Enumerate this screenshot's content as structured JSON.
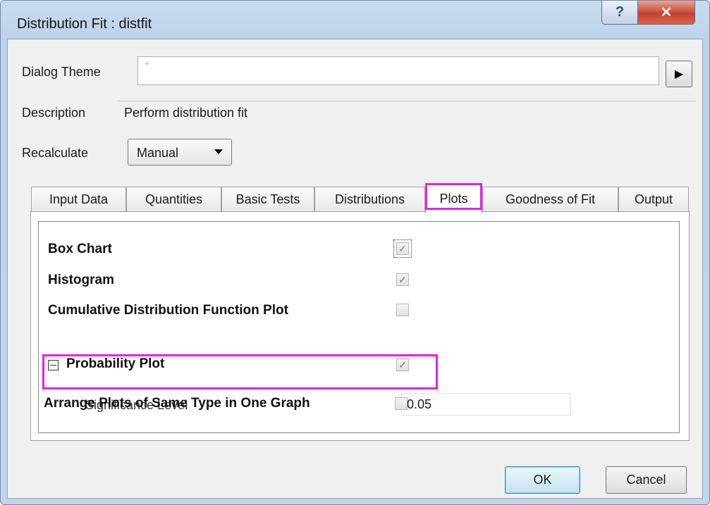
{
  "window": {
    "title": "Distribution Fit : distfit",
    "help_label": "?",
    "close_label": "✕"
  },
  "theme": {
    "label": "Dialog Theme",
    "value": "*",
    "arrow": "▶"
  },
  "description": {
    "label": "Description",
    "value": "Perform distribution fit"
  },
  "recalculate": {
    "label": "Recalculate",
    "value": "Manual"
  },
  "tabs": [
    {
      "label": "Input Data"
    },
    {
      "label": "Quantities"
    },
    {
      "label": "Basic Tests"
    },
    {
      "label": "Distributions"
    },
    {
      "label": "Plots"
    },
    {
      "label": "Goodness of Fit"
    },
    {
      "label": "Output"
    }
  ],
  "active_tab": "Plots",
  "highlight_color": "#e81ee8",
  "plots": {
    "box_chart": {
      "label": "Box Chart",
      "checked": true
    },
    "histogram": {
      "label": "Histogram",
      "checked": true
    },
    "cdf_plot": {
      "label": "Cumulative Distribution Function Plot",
      "checked": false
    },
    "probability_plot": {
      "label": "Probability Plot",
      "checked": true,
      "expanded": true
    },
    "significance_level": {
      "label": "Significance Level",
      "value": "0.05"
    },
    "arrange": {
      "label": "Arrange Plots of Same Type in One Graph",
      "checked": false
    }
  },
  "buttons": {
    "ok": "OK",
    "cancel": "Cancel"
  },
  "check_mark": "✓"
}
